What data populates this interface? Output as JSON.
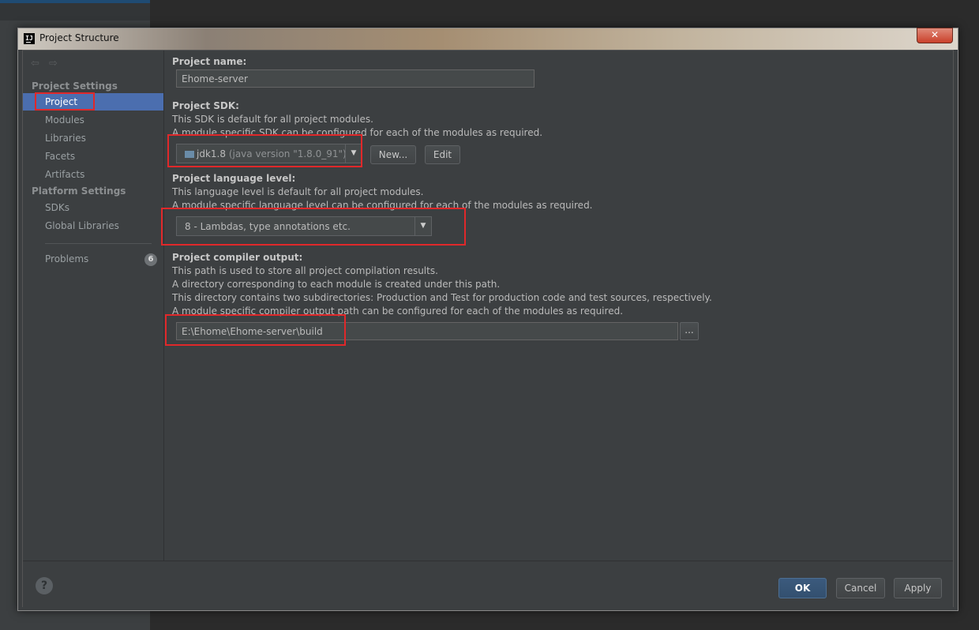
{
  "window": {
    "title": "Project Structure",
    "close_glyph": "✕",
    "app_icon_text": "IJ"
  },
  "nav": {
    "back_glyph": "⇦",
    "forward_glyph": "⇨"
  },
  "sidebar": {
    "project_settings_header": "Project Settings",
    "project_settings_items": [
      "Project",
      "Modules",
      "Libraries",
      "Facets",
      "Artifacts"
    ],
    "platform_settings_header": "Platform Settings",
    "platform_settings_items": [
      "SDKs",
      "Global Libraries"
    ],
    "problems_label": "Problems",
    "problems_count": "6"
  },
  "content": {
    "project_name_label": "Project name:",
    "project_name_value": "Ehome-server",
    "sdk_label": "Project SDK:",
    "sdk_desc_1": "This SDK is default for all project modules.",
    "sdk_desc_2": "A module specific SDK can be configured for each of the modules as required.",
    "sdk_value": "jdk1.8",
    "sdk_version": "(java version \"1.8.0_91\")",
    "new_button": "New...",
    "edit_button": "Edit",
    "lang_label": "Project language level:",
    "lang_desc_1": "This language level is default for all project modules.",
    "lang_desc_2": "A module specific language level can be configured for each of the modules as required.",
    "lang_value": "8 - Lambdas, type annotations etc.",
    "output_label": "Project compiler output:",
    "output_desc_1": "This path is used to store all project compilation results.",
    "output_desc_2": "A directory corresponding to each module is created under this path.",
    "output_desc_3": "This directory contains two subdirectories: Production and Test for production code and test sources, respectively.",
    "output_desc_4": "A module specific compiler output path can be configured for each of the modules as required.",
    "output_value": "E:\\Ehome\\Ehome-server\\build",
    "browse_button": "..."
  },
  "footer": {
    "help_glyph": "?",
    "ok": "OK",
    "cancel": "Cancel",
    "apply": "Apply"
  },
  "colors": {
    "highlight": "#e0282a",
    "selection": "#4b6eaf",
    "background": "#3c3f41"
  }
}
